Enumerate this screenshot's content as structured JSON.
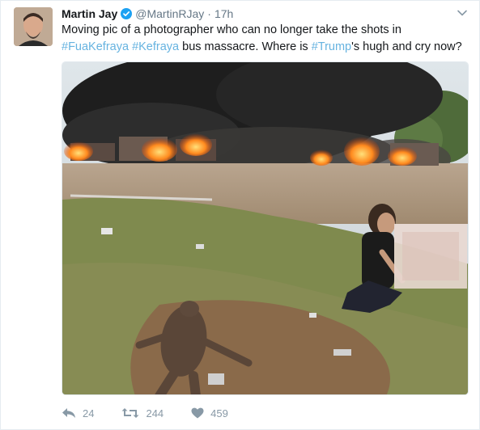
{
  "tweet": {
    "author_name": "Martin Jay",
    "handle": "@MartinRJay",
    "separator": "·",
    "timestamp": "17h",
    "text_1": "Moving pic of a photographer who can no longer take the shots in ",
    "hashtag_1": "#FuaKefraya",
    "text_2": " ",
    "hashtag_2": "#Kefraya",
    "text_3": " bus massacre. Where is ",
    "hashtag_3": "#Trump",
    "text_4": "'s hugh and cry now?"
  },
  "actions": {
    "reply_count": "24",
    "retweet_count": "244",
    "like_count": "459"
  },
  "icons": {
    "verified": "verified-badge-icon",
    "more": "chevron-down-icon",
    "reply": "reply-icon",
    "retweet": "retweet-icon",
    "like": "heart-icon"
  },
  "colors": {
    "accent": "#1da1f2",
    "hashtag": "#66b3e0",
    "muted": "#8899a6"
  }
}
